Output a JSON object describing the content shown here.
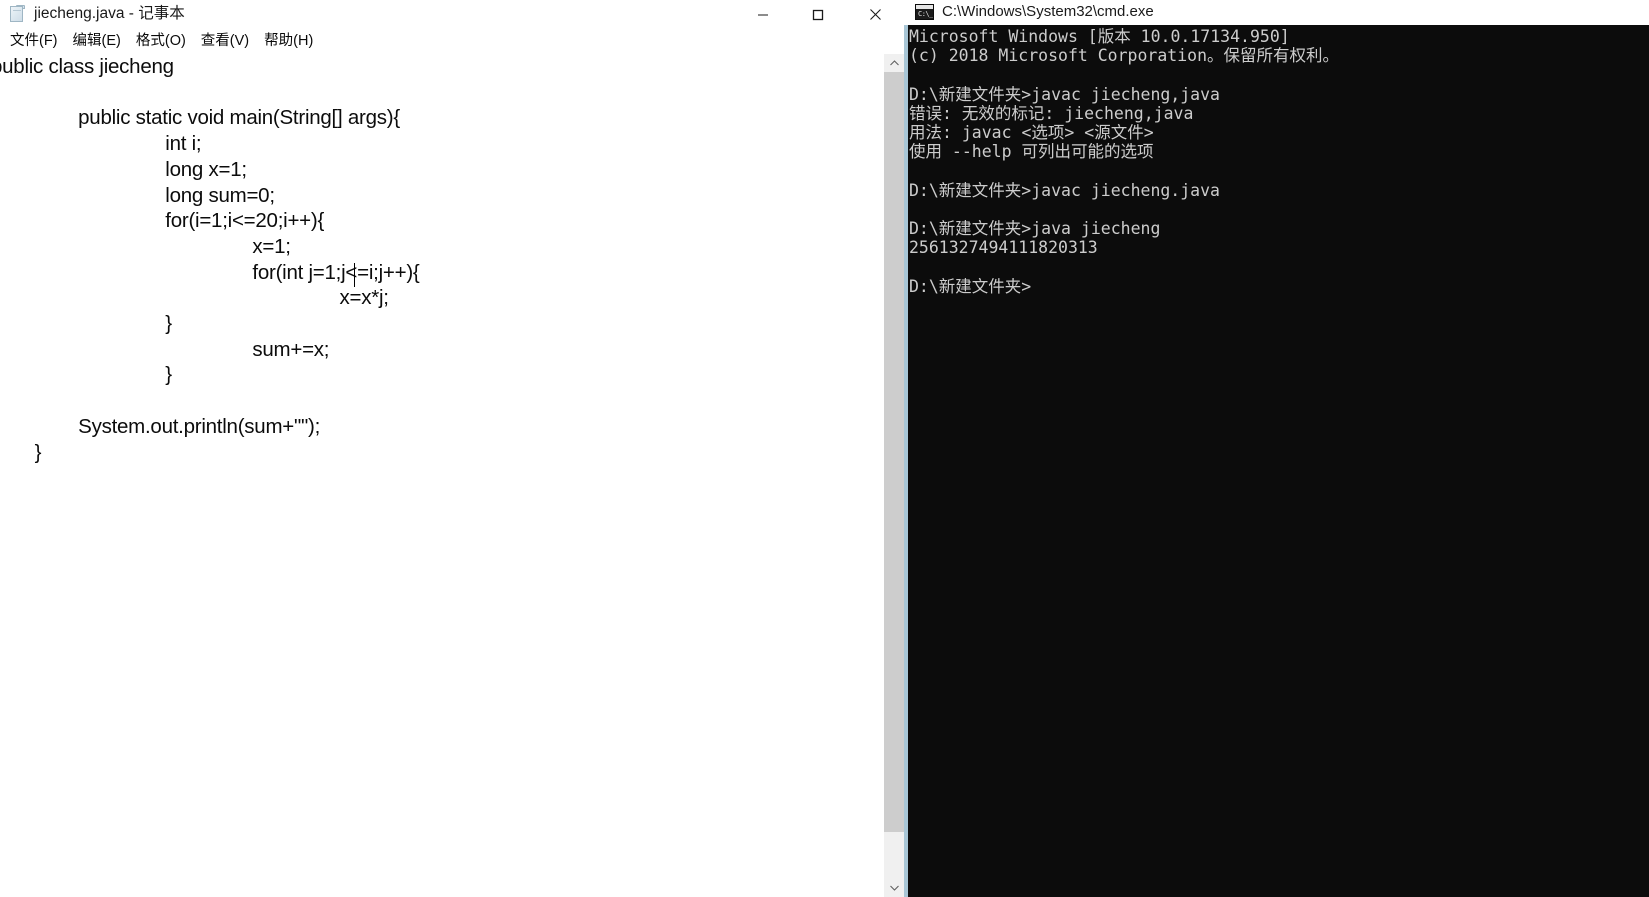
{
  "notepad": {
    "title": "jiecheng.java - 记事本",
    "icon": "notepad-document-icon",
    "window_controls": {
      "minimize": "最小化",
      "maximize": "最大化",
      "close": "关闭"
    },
    "menu": [
      {
        "label": "文件(F)",
        "name": "menu-file"
      },
      {
        "label": "编辑(E)",
        "name": "menu-edit"
      },
      {
        "label": "格式(O)",
        "name": "menu-format"
      },
      {
        "label": "查看(V)",
        "name": "menu-view"
      },
      {
        "label": "帮助(H)",
        "name": "menu-help"
      }
    ],
    "editor": {
      "content": "public class jiecheng\n{\n\t\tpublic static void main(String[] args){\n\t\t\t\tint i;\n\t\t\t\tlong x=1;\n\t\t\t\tlong sum=0;\n\t\t\t\tfor(i=1;i<=20;i++){\n\t\t\t\t\t\tx=1;\n\t\t\t\t\t\tfor(int j=1;j<=i;j++){\n\t\t\t\t\t\t\t\tx=x*j;\n\t\t\t\t}\n\t\t\t\t\t\tsum+=x;\n\t\t\t\t}\n\n\t\tSystem.out.println(sum+\"\");\n\t}\n}",
      "scrollbar": {
        "up_arrow": "scroll-up-icon",
        "down_arrow": "scroll-down-icon"
      }
    }
  },
  "cmd": {
    "title": "C:\\Windows\\System32\\cmd.exe",
    "icon": "cmd-console-icon",
    "console_output": "Microsoft Windows [版本 10.0.17134.950]\n(c) 2018 Microsoft Corporation。保留所有权利。\n\nD:\\新建文件夹>javac jiecheng,java\n错误: 无效的标记: jiecheng,java\n用法: javac <选项> <源文件>\n使用 --help 可列出可能的选项\n\nD:\\新建文件夹>javac jiecheng.java\n\nD:\\新建文件夹>java jiecheng\n2561327494111820313\n\nD:\\新建文件夹>",
    "lines": [
      "Microsoft Windows [版本 10.0.17134.950]",
      "(c) 2018 Microsoft Corporation。保留所有权利。",
      "",
      "D:\\新建文件夹>javac jiecheng,java",
      "错误: 无效的标记: jiecheng,java",
      "用法: javac <选项> <源文件>",
      "使用 --help 可列出可能的选项",
      "",
      "D:\\新建文件夹>javac jiecheng.java",
      "",
      "D:\\新建文件夹>java jiecheng",
      "2561327494111820313",
      "",
      "D:\\新建文件夹>"
    ],
    "result_value": "2561327494111820313",
    "working_directory": "D:\\新建文件夹",
    "prompt": "D:\\新建文件夹>",
    "commands": [
      "javac jiecheng,java",
      "javac jiecheng.java",
      "java jiecheng"
    ]
  },
  "colors": {
    "console_bg": "#0c0c0c",
    "console_fg": "#cccccc",
    "window_bg": "#ffffff",
    "text_fg": "#0c0c0c",
    "scrollbar_track": "#f0f0f0",
    "scrollbar_thumb": "#cdcdcd",
    "cmd_edge": "#a8c6d6"
  }
}
